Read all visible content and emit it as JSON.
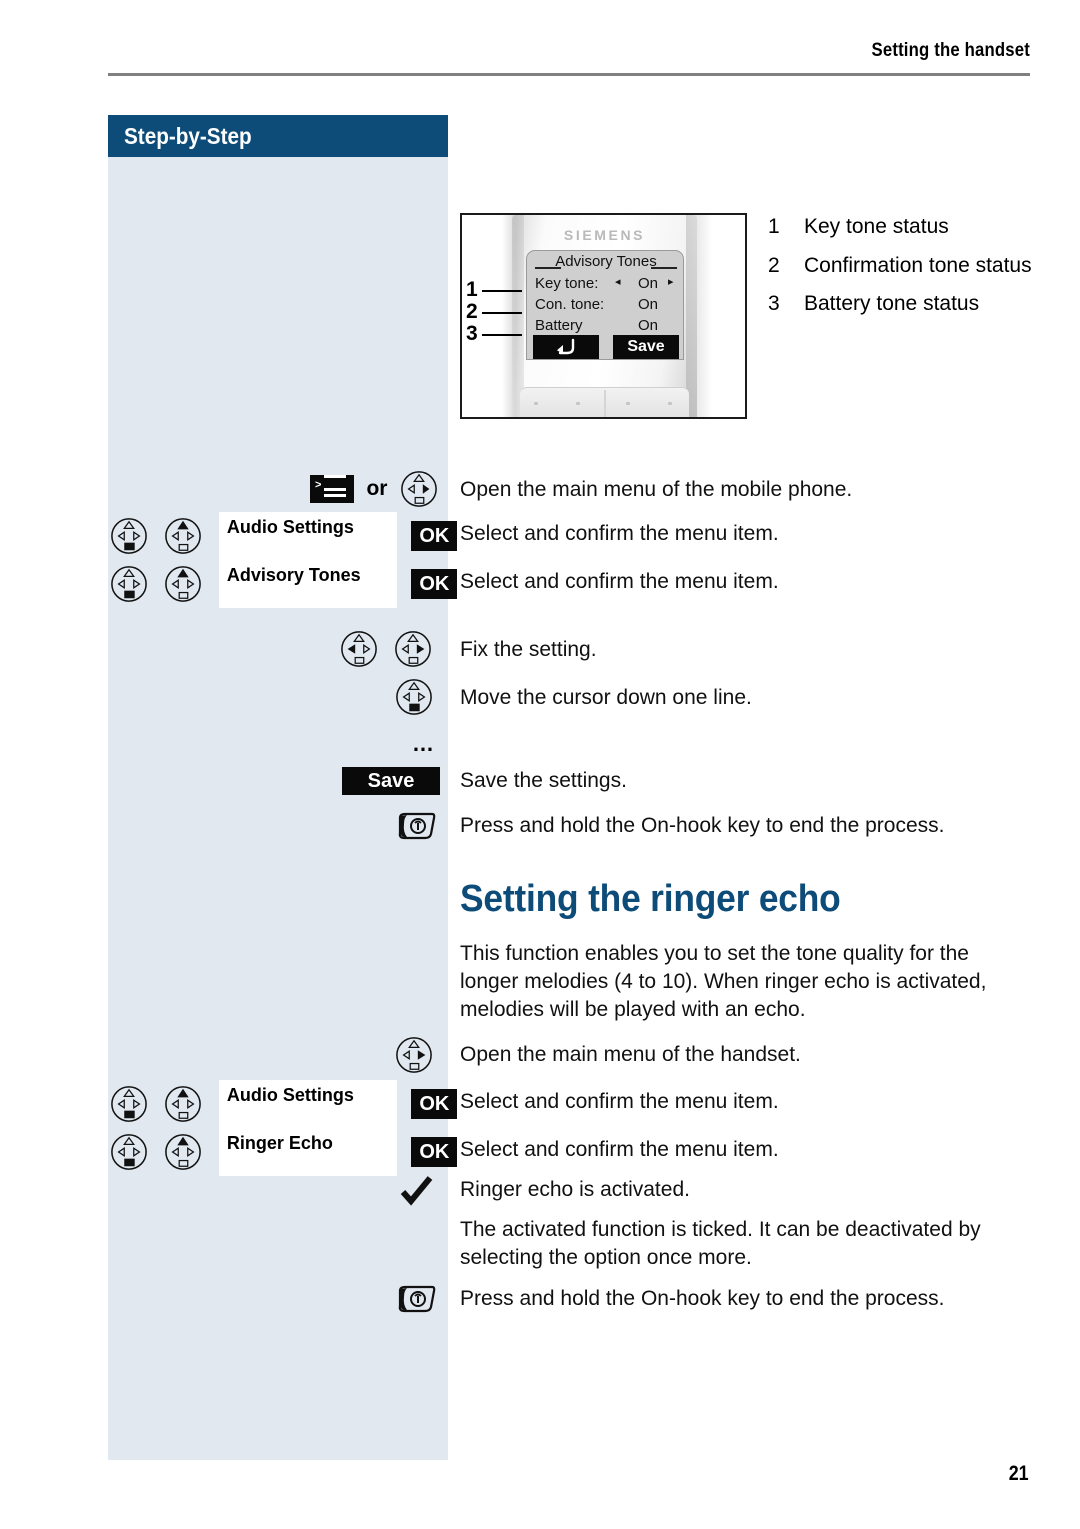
{
  "header": {
    "running_title": "Setting the handset"
  },
  "sidebar": {
    "title": "Step-by-Step"
  },
  "phone_illustration": {
    "brand": "SIEMENS",
    "screen_title": "Advisory Tones",
    "rows": [
      {
        "label": "Key tone:",
        "value": "On",
        "left_arrow": "◂",
        "right_arrow": "▸"
      },
      {
        "label": "Con. tone:",
        "value": "On",
        "left_arrow": "",
        "right_arrow": ""
      },
      {
        "label": "Battery",
        "value": "On",
        "left_arrow": "",
        "right_arrow": ""
      }
    ],
    "softkey_left": "back-arrow-icon",
    "softkey_right": "Save",
    "callouts": [
      "1",
      "2",
      "3"
    ]
  },
  "legend": [
    {
      "num": "1",
      "text": "Key tone status"
    },
    {
      "num": "2",
      "text": "Confirmation tone status"
    },
    {
      "num": "3",
      "text": "Battery tone status"
    }
  ],
  "advisory_tones_steps": [
    {
      "menu_icon": "menu-icon",
      "or": "or",
      "nav": "nav-right",
      "text": "Open the main menu of the mobile phone."
    },
    {
      "nav_a": "nav-down",
      "nav_b": "nav-up",
      "menu_label": "Audio Settings",
      "ok": "OK",
      "text": "Select and confirm the menu item."
    },
    {
      "nav_a": "nav-down",
      "nav_b": "nav-up",
      "menu_label": "Advisory Tones",
      "ok": "OK",
      "text": "Select and confirm the menu item."
    },
    {
      "nav_a": "nav-left",
      "nav_b": "nav-right",
      "text": "Fix the setting."
    },
    {
      "nav_a": "nav-down",
      "text": "Move the cursor down one line."
    },
    {
      "dots": "…"
    },
    {
      "save": "Save",
      "text": "Save the settings."
    },
    {
      "onhook": "on-hook-key-icon",
      "text": "Press and hold the On-hook key to end the process."
    }
  ],
  "ringer_echo": {
    "heading": "Setting the ringer echo",
    "intro": "This function enables you to set the tone quality for the longer melodies (4 to 10). When ringer echo is activated, melodies will be played with an echo.",
    "steps": [
      {
        "nav": "nav-right",
        "text": "Open the main menu of the handset."
      },
      {
        "nav_a": "nav-down",
        "nav_b": "nav-up",
        "menu_label": "Audio Settings",
        "ok": "OK",
        "text": "Select and confirm the menu item."
      },
      {
        "nav_a": "nav-down",
        "nav_b": "nav-up",
        "menu_label": "Ringer Echo",
        "ok": "OK",
        "text": "Select and confirm the menu item."
      },
      {
        "tick": "checkmark-icon",
        "text": "Ringer echo is activated."
      }
    ],
    "note": "The activated function is ticked. It can be deactivated by selecting the option once more.",
    "end_step": {
      "onhook": "on-hook-key-icon",
      "text": "Press and hold the On-hook key to end the process."
    }
  },
  "footer": {
    "page_number": "21"
  },
  "colors": {
    "brand_blue": "#0d4c79",
    "sidebar_bg": "#e2e8f0",
    "rule_gray": "#808080",
    "key_black": "#0a0a0a"
  }
}
